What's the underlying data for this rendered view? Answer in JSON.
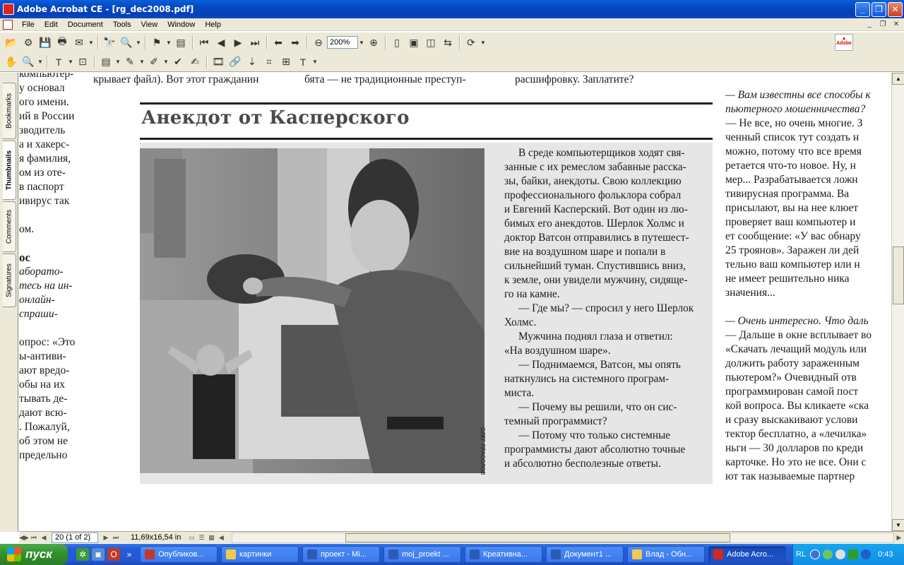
{
  "window": {
    "title": "Adobe Acrobat CE - [rg_dec2008.pdf]"
  },
  "menu": [
    "File",
    "Edit",
    "Document",
    "Tools",
    "View",
    "Window",
    "Help"
  ],
  "toolbar": {
    "zoom_value": "200%",
    "adobe_label": "Adobe"
  },
  "nav_tabs": [
    "Bookmarks",
    "Thumbnails",
    "Comments",
    "Signatures"
  ],
  "document": {
    "top_lines": {
      "left": "компьютер-",
      "mid1": "крывает файл). Вот этот гражданин",
      "mid2": "бята — не традиционные преступ-",
      "mid3": "расшифровку. Заплатите?"
    },
    "left_column": [
      {
        "text": "компьютер-",
        "italic": false
      },
      {
        "text": "у основал",
        "italic": false
      },
      {
        "text": "ого имени.",
        "italic": false
      },
      {
        "text": "ий в России",
        "italic": false
      },
      {
        "text": "зводитель",
        "italic": false
      },
      {
        "text": "а и хакерс-",
        "italic": false
      },
      {
        "text": "я фамилия,",
        "italic": false
      },
      {
        "text": "ом из оте-",
        "italic": false
      },
      {
        "text": "в паспорт",
        "italic": false
      },
      {
        "text": "ивирус так",
        "italic": false
      },
      {
        "text": "",
        "italic": false
      },
      {
        "text": "ом.",
        "italic": false
      },
      {
        "text": "",
        "italic": false
      },
      {
        "text": "ос",
        "italic": false,
        "bold": true
      },
      {
        "text": "аборато-",
        "italic": true
      },
      {
        "text": "тесь на ин-",
        "italic": true
      },
      {
        "text": "онлайн-",
        "italic": true
      },
      {
        "text": "спраши-",
        "italic": true
      },
      {
        "text": "",
        "italic": false
      },
      {
        "text": "опрос: «Это",
        "italic": false
      },
      {
        "text": "ы-антиви-",
        "italic": false
      },
      {
        "text": "ают вредо-",
        "italic": false
      },
      {
        "text": "обы на их",
        "italic": false
      },
      {
        "text": "тывать де-",
        "italic": false
      },
      {
        "text": "дают всю-",
        "italic": false
      },
      {
        "text": ". Пожалуй,",
        "italic": false
      },
      {
        "text": "об этом не",
        "italic": false
      },
      {
        "text": "предельно",
        "italic": false
      }
    ],
    "box": {
      "headline": "Анекдот от Касперского",
      "photo_credit": "ОЛЕГ ПРАСОЛОВ",
      "story_lines": [
        "В среде компьютерщиков ходят свя-",
        "занные с их ремеслом забавные расска-",
        "зы, байки, анекдоты. Свою коллекцию",
        "профессионального фольклора собрал",
        "и Евгений Касперский. Вот один из лю-",
        "бимых его анекдотов. Шерлок Холмс и",
        "доктор Ватсон отправились в путешест-",
        "вие на  воздушном шаре и попали в",
        "сильнейший туман. Спустившись вниз,",
        "к земле, они увидели мужчину, сидяще-",
        "го на камне.",
        "— Где мы? — спросил у него Шерлок",
        "Холмс.",
        "Мужчина поднял глаза и ответил:",
        "«На воздушном шаре».",
        "— Поднимаемся, Ватсон, мы опять",
        "наткнулись на системного програм-",
        "миста.",
        "— Почему вы решили, что он сис-",
        "темный программист?",
        "— Потому что только системные",
        "программисты дают абсолютно точные",
        "и абсолютно бесполезные ответы."
      ]
    },
    "right_column": [
      {
        "text": "— Вам известны все способы к",
        "italic": true
      },
      {
        "text": "пьютерного мошенничества?",
        "italic": true
      },
      {
        "text": "— Не все, но очень многие. З",
        "italic": false
      },
      {
        "text": "ченный список тут создать н",
        "italic": false
      },
      {
        "text": "можно, потому что все время",
        "italic": false
      },
      {
        "text": "ретается что-то новое. Ну, н",
        "italic": false
      },
      {
        "text": "мер... Разрабатывается ложн",
        "italic": false
      },
      {
        "text": "тивирусная программа. Ва",
        "italic": false
      },
      {
        "text": "присылают, вы на нее клюет",
        "italic": false
      },
      {
        "text": "проверяет ваш компьютер и",
        "italic": false
      },
      {
        "text": "ет сообщение: «У вас обнару",
        "italic": false
      },
      {
        "text": "25 троянов». Заражен ли дей",
        "italic": false
      },
      {
        "text": "тельно ваш компьютер или н",
        "italic": false
      },
      {
        "text": "не имеет решительно ника",
        "italic": false
      },
      {
        "text": "значения...",
        "italic": false
      },
      {
        "text": "",
        "italic": false
      },
      {
        "text": "— Очень интересно. Что даль",
        "italic": true
      },
      {
        "text": "— Дальше в окне всплывает во",
        "italic": false
      },
      {
        "text": "«Скачать лечащий модуль или",
        "italic": false
      },
      {
        "text": "должить работу зараженным",
        "italic": false
      },
      {
        "text": "пьютером?» Очевидный отв",
        "italic": false
      },
      {
        "text": "программирован самой пост",
        "italic": false
      },
      {
        "text": "кой вопроса. Вы кликаете «ска",
        "italic": false
      },
      {
        "text": "и сразу выскакивают услови",
        "italic": false
      },
      {
        "text": "тектор бесплатно, а «лечилка»",
        "italic": false
      },
      {
        "text": "ньги — 30 долларов по креди",
        "italic": false
      },
      {
        "text": "карточке. Но это не все. Они с",
        "italic": false
      },
      {
        "text": "ют так называемые партнер",
        "italic": false
      }
    ]
  },
  "statusbar": {
    "page_field": "20 (1 of 2)",
    "page_size": "11,69x16,54 in"
  },
  "taskbar": {
    "start_label": "пуск",
    "tasks": [
      {
        "label": "Опубликов...",
        "active": false,
        "color": "#c0392b"
      },
      {
        "label": "картинки",
        "active": false,
        "color": "#f2c94c"
      },
      {
        "label": "проект - Mi...",
        "active": false,
        "color": "#2b5bb8"
      },
      {
        "label": "moj_proekt ...",
        "active": false,
        "color": "#2b5bb8"
      },
      {
        "label": "Креативна...",
        "active": false,
        "color": "#2b5bb8"
      },
      {
        "label": "Документ1 ...",
        "active": false,
        "color": "#2b5bb8"
      },
      {
        "label": "Влад - Обн...",
        "active": false,
        "color": "#f2c94c"
      },
      {
        "label": "Adobe Acro...",
        "active": true,
        "color": "#d8261e"
      }
    ],
    "tray_lang": "RL",
    "clock": "0:43"
  }
}
